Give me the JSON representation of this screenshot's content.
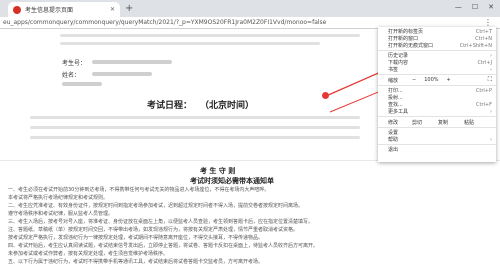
{
  "tab": {
    "title": "考生信息提示页面"
  },
  "address": {
    "url": "eu_apps/commonquery/commonquery/queryMatch/2021/?_p=YXM9OS20FR1Jra0M2Z0FI1Vvd/monoo=false"
  },
  "content": {
    "field_labels": [
      "考生号：",
      "姓名："
    ],
    "exam_date_label": "考试日程：",
    "exam_zone": "（北京时间）",
    "rules_title": "考 生 守 则",
    "rules_subtitle": "考试时须知必需带本通知单",
    "paragraphs": [
      "一、考生必须在考试开始前30分钟到达考场，不得携带任何与考试无关的物品进入考场座位，不得在考场内大声喧哗。",
      "本考试将严格执行考场纪律规定和考试规则。",
      "二、考生应凭准考证、有效身份证件，按规定时间到指定考场参加考试，迟到超过规定时间者不得入场，提前交卷者按规定时间离场。",
      "遵守考场秩序和考试纪律，服从监考人员管理。",
      "三、考生入场后，按考号对号入座，将准考证、身份证放在桌面左上角，以便监考人员查验，考生领到答题卡后，应在指定位置清楚填写。",
      "注、答题纸、草稿纸（单）按规定时间交回，不得带出考场，如发现违规行为，将按有关规定严肃处理，情节严重者取消考试资格。",
      "按考试规定严格执行，发现违纪行为一律按规定处理，考试期间不得随意离开座位，不得交头接耳，不得传递物品。",
      "四、考试开始后，考生应认真阅读试题，考试结束信号发出后，立即停止答题，将试卷、答题卡反扣在桌面上，待监考人员收齐后方可离开。",
      "未参加考试或考试作弊者，按有关规定处理，考生须自觉维护考场秩序。",
      "五、以下行为属于违纪行为，考试时不得携带手机等通讯工具，考试结束后将试卷答题卡交监考员，方可离开考场。"
    ]
  },
  "menu": {
    "items_top": [
      {
        "label": "打开新的标签页",
        "shortcut": "Ctrl+T"
      },
      {
        "label": "打开新的窗口",
        "shortcut": "Ctrl+N"
      },
      {
        "label": "打开新的无痕式窗口",
        "shortcut": "Ctrl+Shift+N"
      }
    ],
    "items_mid": [
      {
        "label": "历史记录",
        "shortcut": ""
      },
      {
        "label": "下载内容",
        "shortcut": "Ctrl+J"
      },
      {
        "label": "书签",
        "shortcut": ""
      }
    ],
    "zoom": {
      "label": "缩放",
      "minus": "−",
      "value": "100%",
      "plus": "+",
      "fullscreen": "⛶"
    },
    "items_print": [
      {
        "label": "打印...",
        "shortcut": "Ctrl+P"
      },
      {
        "label": "投射...",
        "shortcut": ""
      },
      {
        "label": "查找...",
        "shortcut": "Ctrl+F"
      },
      {
        "label": "更多工具",
        "shortcut": ""
      }
    ],
    "edit": {
      "label": "修改",
      "cut": "剪切",
      "copy": "复制",
      "paste": "粘贴"
    },
    "items_bottom": [
      {
        "label": "设置",
        "shortcut": ""
      },
      {
        "label": "帮助",
        "shortcut": ""
      },
      {
        "label": "退出",
        "shortcut": ""
      }
    ]
  },
  "colors": {
    "annotation": "#e53935",
    "tabbar": "#dee1e6"
  }
}
